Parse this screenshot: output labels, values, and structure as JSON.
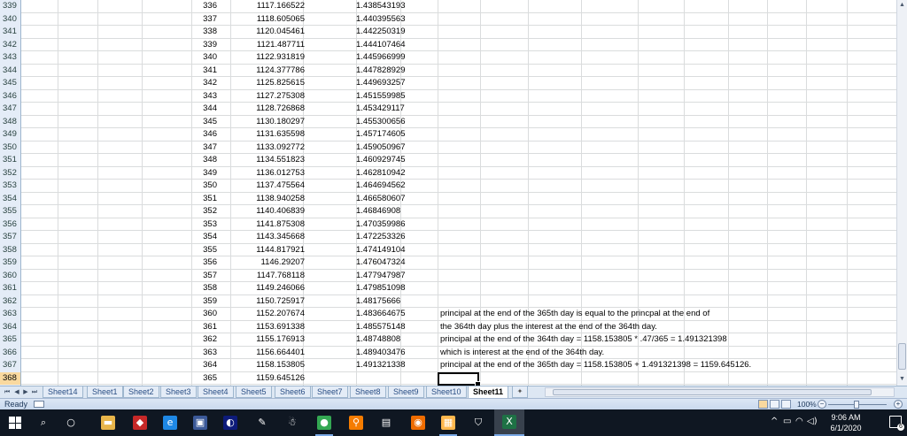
{
  "sheet": {
    "rows": [
      {
        "row": "339",
        "a": "336",
        "b": "1117.166522",
        "c": "1.438543193",
        "note": ""
      },
      {
        "row": "340",
        "a": "337",
        "b": "1118.605065",
        "c": "1.440395563",
        "note": ""
      },
      {
        "row": "341",
        "a": "338",
        "b": "1120.045461",
        "c": "1.442250319",
        "note": ""
      },
      {
        "row": "342",
        "a": "339",
        "b": "1121.487711",
        "c": "1.444107464",
        "note": ""
      },
      {
        "row": "343",
        "a": "340",
        "b": "1122.931819",
        "c": "1.445966999",
        "note": ""
      },
      {
        "row": "344",
        "a": "341",
        "b": "1124.377786",
        "c": "1.447828929",
        "note": ""
      },
      {
        "row": "345",
        "a": "342",
        "b": "1125.825615",
        "c": "1.449693257",
        "note": ""
      },
      {
        "row": "346",
        "a": "343",
        "b": "1127.275308",
        "c": "1.451559985",
        "note": ""
      },
      {
        "row": "347",
        "a": "344",
        "b": "1128.726868",
        "c": "1.453429117",
        "note": ""
      },
      {
        "row": "348",
        "a": "345",
        "b": "1130.180297",
        "c": "1.455300656",
        "note": ""
      },
      {
        "row": "349",
        "a": "346",
        "b": "1131.635598",
        "c": "1.457174605",
        "note": ""
      },
      {
        "row": "350",
        "a": "347",
        "b": "1133.092772",
        "c": "1.459050967",
        "note": ""
      },
      {
        "row": "351",
        "a": "348",
        "b": "1134.551823",
        "c": "1.460929745",
        "note": ""
      },
      {
        "row": "352",
        "a": "349",
        "b": "1136.012753",
        "c": "1.462810942",
        "note": ""
      },
      {
        "row": "353",
        "a": "350",
        "b": "1137.475564",
        "c": "1.464694562",
        "note": ""
      },
      {
        "row": "354",
        "a": "351",
        "b": "1138.940258",
        "c": "1.466580607",
        "note": ""
      },
      {
        "row": "355",
        "a": "352",
        "b": "1140.406839",
        "c": "1.46846908",
        "note": ""
      },
      {
        "row": "356",
        "a": "353",
        "b": "1141.875308",
        "c": "1.470359986",
        "note": ""
      },
      {
        "row": "357",
        "a": "354",
        "b": "1143.345668",
        "c": "1.472253326",
        "note": ""
      },
      {
        "row": "358",
        "a": "355",
        "b": "1144.817921",
        "c": "1.474149104",
        "note": ""
      },
      {
        "row": "359",
        "a": "356",
        "b": "1146.29207",
        "c": "1.476047324",
        "note": ""
      },
      {
        "row": "360",
        "a": "357",
        "b": "1147.768118",
        "c": "1.477947987",
        "note": ""
      },
      {
        "row": "361",
        "a": "358",
        "b": "1149.246066",
        "c": "1.479851098",
        "note": ""
      },
      {
        "row": "362",
        "a": "359",
        "b": "1150.725917",
        "c": "1.48175666",
        "note": ""
      },
      {
        "row": "363",
        "a": "360",
        "b": "1152.207674",
        "c": "1.483664675",
        "note": "principal at the end of the 365th day is equal to the princpal at the end of"
      },
      {
        "row": "364",
        "a": "361",
        "b": "1153.691338",
        "c": "1.485575148",
        "note": "the 364th day plus the interest at the end of the 364th day."
      },
      {
        "row": "365",
        "a": "362",
        "b": "1155.176913",
        "c": "1.48748808",
        "note": "principal at the end of the 364th day = 1158.153805 * .47/365 = 1.491321398"
      },
      {
        "row": "366",
        "a": "363",
        "b": "1156.664401",
        "c": "1.489403476",
        "note": "which is interest at the end of the 364th day."
      },
      {
        "row": "367",
        "a": "364",
        "b": "1158.153805",
        "c": "1.491321338",
        "note": "principal at the end of the 365th day = 1158.153805 + 1.491321398 = 1159.645126."
      },
      {
        "row": "368",
        "a": "365",
        "b": "1159.645126",
        "c": "",
        "note": ""
      },
      {
        "row": "369",
        "a": "",
        "b": "",
        "c": "",
        "note": ""
      }
    ],
    "active_row": "368"
  },
  "tabs": [
    "Sheet14",
    "Sheet1",
    "Sheet2",
    "Sheet3",
    "Sheet4",
    "Sheet5",
    "Sheet6",
    "Sheet7",
    "Sheet8",
    "Sheet9",
    "Sheet10",
    "Sheet11"
  ],
  "active_tab": "Sheet11",
  "status": {
    "ready": "Ready",
    "zoom": "100%"
  },
  "clock": {
    "time": "9:06 AM",
    "date": "6/1/2020"
  },
  "notifications": "6",
  "taskbar": [
    "start",
    "search",
    "task-view",
    "file-explorer",
    "app",
    "edge",
    "store",
    "app",
    "app",
    "app",
    "chrome",
    "search-app",
    "app",
    "app",
    "app",
    "app",
    "excel"
  ]
}
